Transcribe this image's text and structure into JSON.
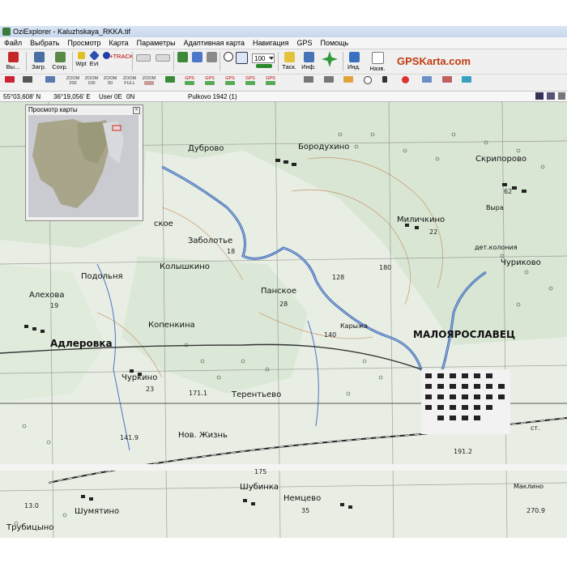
{
  "window": {
    "title": "OziExplorer - Kaluzhskaya_RKKA.tif"
  },
  "menu": [
    "Файл",
    "Выбрать",
    "Просмотр",
    "Карта",
    "Параметры",
    "Адаптивная карта",
    "Навигация",
    "GPS",
    "Помощь"
  ],
  "toolbar": {
    "exit": "Вы...",
    "load": "Загр.",
    "save": "Сохр.",
    "wp": "Wpt",
    "evt": "Evt",
    "track": "+TRACK",
    "zoom_value": "100",
    "task": "Таск.",
    "info": "Инф.",
    "ind": "Инд.",
    "name": "Назв."
  },
  "toolbar2": {
    "zoom200": "200",
    "zoom100": "100",
    "zoom50": "50",
    "zoomfull": "FULL",
    "zoom_word": "ZOOM",
    "gps_word": "GPS"
  },
  "brand": "GPSKarta.com",
  "status": {
    "lat": "55°03,608' N",
    "lon": "36°19,056' E",
    "user": "User",
    "user_e": "0E",
    "user_n": "0N",
    "datum": "Pulkovo 1942 (1)"
  },
  "overview": {
    "title": "Просмотр карты"
  },
  "map_labels": {
    "dubrovo": "Дуброво",
    "borodukhino": "Бородухино",
    "skriporovo": "Скрипорово",
    "milichkino": "Миличкино",
    "churikovo": "Чуриково",
    "det_kolonia": "дет.колония",
    "zabolotye": "Заболотье",
    "koloshkino": "Колышкино",
    "panskoe": "Панское",
    "ok": "ское",
    "podolnya": "Подольня",
    "alekhova": "Алехова",
    "kopenkina": "Копенкина",
    "adlerovka": "Адлеровка",
    "maloyaroslavets": "МАЛОЯРОСЛАВЕЦ",
    "churkino": "Чуркино",
    "terentyevo": "Терентьево",
    "nov_zhizn": "Нов. Жизнь",
    "shubinka": "Шубинка",
    "nemtsevo": "Немцево",
    "shumyatino": "Шумятино",
    "trubitsyno": "Трубицыно",
    "maklino": "Маклино",
    "karyzha": "Карыжа",
    "n171": "171.1",
    "n141": "141.9",
    "n180": "180",
    "n128": "128",
    "n140": "140",
    "n191": "191.2",
    "n175": "175",
    "n22": "22",
    "n28": "28",
    "n35": "35",
    "n19": "19",
    "n18": "18",
    "n23": "23",
    "n62": "62",
    "st": "ст.",
    "n130": "13.0",
    "n270": "270.9",
    "vyra": "Выра"
  }
}
